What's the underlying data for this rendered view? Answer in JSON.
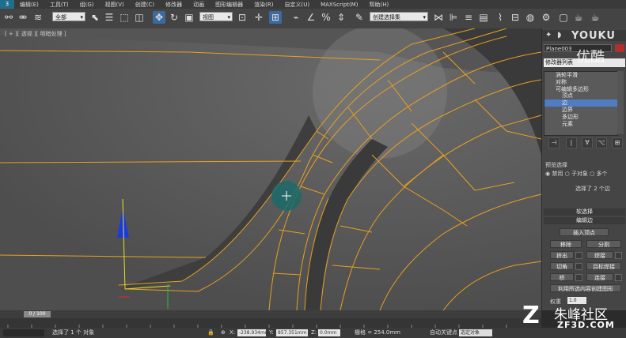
{
  "menu": {
    "logo": "3",
    "items": [
      "编辑(E)",
      "工具(T)",
      "组(G)",
      "视图(V)",
      "创建(C)",
      "修改器",
      "动画",
      "图形编辑器",
      "渲染(R)",
      "自定义(U)",
      "MAXScript(M)",
      "帮助(H)"
    ]
  },
  "toolbar": {
    "selection_filter": "全部",
    "ref_coord": "视图",
    "named_selection": "创建选择集"
  },
  "viewport": {
    "label": "[ + ][ 透视 ][ 明暗处理 ]"
  },
  "command_panel": {
    "object_name": "Plane003",
    "modifier_list": "修改器列表",
    "stack": [
      {
        "label": "涡轮平滑",
        "level": 1,
        "selected": false
      },
      {
        "label": "对称",
        "level": 1,
        "selected": false
      },
      {
        "label": "可编辑多边形",
        "level": 1,
        "selected": false
      },
      {
        "label": "顶点",
        "level": 2,
        "selected": false
      },
      {
        "label": "边",
        "level": 2,
        "selected": true
      },
      {
        "label": "边界",
        "level": 2,
        "selected": false
      },
      {
        "label": "多边形",
        "level": 2,
        "selected": false
      },
      {
        "label": "元素",
        "level": 2,
        "selected": false
      }
    ],
    "preview_selection": {
      "title": "预览选择",
      "options": [
        "禁用",
        "子对象",
        "多个"
      ],
      "status": "选择了 2 个边"
    },
    "soft_selection": "软选择",
    "edit_edges": {
      "title": "编辑边",
      "insert_vertex": "插入顶点",
      "remove": "移除",
      "split": "分割",
      "extrude": "挤出",
      "weld": "焊接",
      "chamfer": "切角",
      "target_weld": "目标焊接",
      "bridge": "桥",
      "connect": "连接",
      "create_shape": "利用所选内容创建图形",
      "weight": "权重",
      "weight_value": "1.0"
    }
  },
  "timeline": {
    "frame": "0 / 100"
  },
  "status": {
    "selection": "选择了 1 个 对象",
    "x_label": "X:",
    "x": "-238.934mm",
    "y_label": "Y:",
    "y": "857.351mm",
    "z_label": "Z:",
    "z": "0.0mm",
    "grid": "栅格 = 254.0mm",
    "auto_key": "自动关键点",
    "set_key": "选定对象"
  },
  "watermark": {
    "youku": "YOUKU",
    "youku_cn": "优酷",
    "zf3d_cn": "朱峰社区",
    "zf3d_url": "ZF3D.COM"
  },
  "colors": {
    "edge": "#e8a020",
    "selected_item": "#4f7cc2",
    "panel_bg": "#454545",
    "viewport_bg": "#5a5a5a",
    "gizmo_blue": "#1a3ae0",
    "gizmo_cursor": "#1c6a6a"
  }
}
